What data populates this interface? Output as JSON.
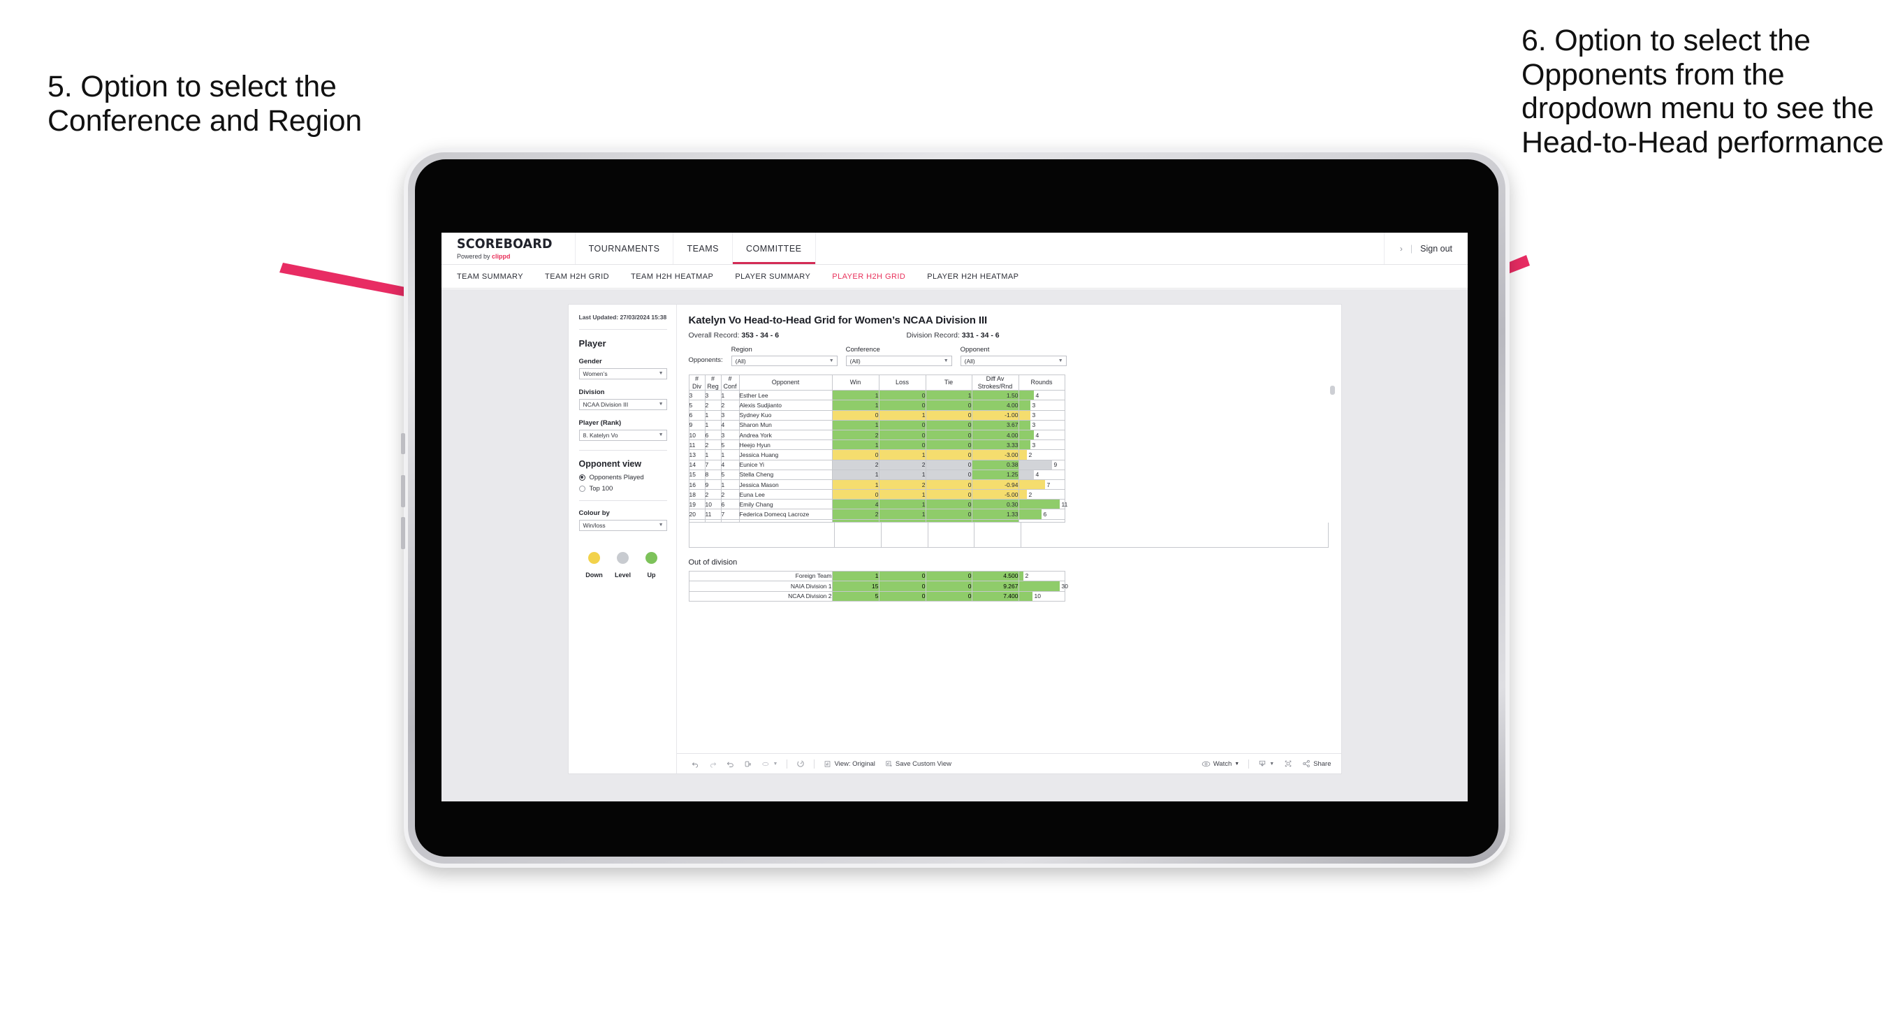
{
  "annotations": {
    "left": "5. Option to select the Conference and Region",
    "right": "6. Option to select the Opponents from the dropdown menu to see the Head-to-Head performance",
    "arrow_color": "#e82c63"
  },
  "app": {
    "brand": {
      "name": "SCOREBOARD",
      "powered_prefix": "Powered by ",
      "powered_brand": "clippd"
    },
    "nav": [
      {
        "label": "TOURNAMENTS",
        "active": false
      },
      {
        "label": "TEAMS",
        "active": false
      },
      {
        "label": "COMMITTEE",
        "active": true
      }
    ],
    "account": {
      "chevron": "›",
      "separator": "|",
      "sign_out": "Sign out"
    },
    "subtabs": [
      {
        "label": "TEAM SUMMARY",
        "active": false
      },
      {
        "label": "TEAM H2H GRID",
        "active": false
      },
      {
        "label": "TEAM H2H HEATMAP",
        "active": false
      },
      {
        "label": "PLAYER SUMMARY",
        "active": false
      },
      {
        "label": "PLAYER H2H GRID",
        "active": true
      },
      {
        "label": "PLAYER H2H HEATMAP",
        "active": false
      }
    ],
    "accent_color": "#e8305a"
  },
  "sidebar": {
    "last_updated": "Last Updated: 27/03/2024 15:38",
    "player_heading": "Player",
    "gender": {
      "label": "Gender",
      "value": "Women’s"
    },
    "division": {
      "label": "Division",
      "value": "NCAA Division III"
    },
    "player_rank": {
      "label": "Player (Rank)",
      "value": "8. Katelyn Vo"
    },
    "opponent_view": {
      "heading": "Opponent view",
      "options": [
        {
          "label": "Opponents Played",
          "selected": true
        },
        {
          "label": "Top 100",
          "selected": false
        }
      ]
    },
    "colour_by": {
      "label": "Colour by",
      "value": "Win/loss"
    },
    "legend": [
      {
        "label": "Down",
        "color": "#f2d24b"
      },
      {
        "label": "Level",
        "color": "#c8cbd0"
      },
      {
        "label": "Up",
        "color": "#7dc25a"
      }
    ]
  },
  "content": {
    "title": "Katelyn Vo Head-to-Head Grid for Women’s NCAA Division III",
    "overall_record_label": "Overall Record: ",
    "overall_record_value": "353 - 34 - 6",
    "division_record_label": "Division Record: ",
    "division_record_value": "331 -  34 - 6",
    "filters": {
      "opponents_label": "Opponents:",
      "fields": [
        {
          "label": "Region",
          "value": "(All)"
        },
        {
          "label": "Conference",
          "value": "(All)"
        },
        {
          "label": "Opponent",
          "value": "(All)"
        }
      ]
    },
    "out_of_division_title": "Out of division"
  },
  "chart_data": {
    "type": "table",
    "title": "Katelyn Vo Head-to-Head Grid for Women’s NCAA Division III",
    "columns": [
      "# Div",
      "# Reg",
      "# Conf",
      "Opponent",
      "Win",
      "Loss",
      "Tie",
      "Diff Av Strokes/Rnd",
      "Rounds"
    ],
    "column_headers_multiline": [
      [
        "#",
        "Div"
      ],
      [
        "#",
        "Reg"
      ],
      [
        "#",
        "Conf"
      ],
      [
        "Opponent"
      ],
      [
        "Win"
      ],
      [
        "Loss"
      ],
      [
        "Tie"
      ],
      [
        "Diff Av",
        "Strokes/Rnd"
      ],
      [
        "Rounds"
      ]
    ],
    "rounds_max": 11,
    "colors": {
      "up": "#8fcc6a",
      "down": "#f5dd6e",
      "level": "#d2d4d8"
    },
    "rows": [
      {
        "div": "3",
        "reg": "3",
        "conf": "1",
        "opponent": "Esther Lee",
        "win": "1",
        "loss": "0",
        "tie": "1",
        "diff": "1.50",
        "rounds": 4,
        "state": "up"
      },
      {
        "div": "5",
        "reg": "2",
        "conf": "2",
        "opponent": "Alexis Sudjianto",
        "win": "1",
        "loss": "0",
        "tie": "0",
        "diff": "4.00",
        "rounds": 3,
        "state": "up"
      },
      {
        "div": "6",
        "reg": "1",
        "conf": "3",
        "opponent": "Sydney Kuo",
        "win": "0",
        "loss": "1",
        "tie": "0",
        "diff": "-1.00",
        "rounds": 3,
        "state": "down"
      },
      {
        "div": "9",
        "reg": "1",
        "conf": "4",
        "opponent": "Sharon Mun",
        "win": "1",
        "loss": "0",
        "tie": "0",
        "diff": "3.67",
        "rounds": 3,
        "state": "up"
      },
      {
        "div": "10",
        "reg": "6",
        "conf": "3",
        "opponent": "Andrea York",
        "win": "2",
        "loss": "0",
        "tie": "0",
        "diff": "4.00",
        "rounds": 4,
        "state": "up"
      },
      {
        "div": "11",
        "reg": "2",
        "conf": "5",
        "opponent": "Heejo Hyun",
        "win": "1",
        "loss": "0",
        "tie": "0",
        "diff": "3.33",
        "rounds": 3,
        "state": "up"
      },
      {
        "div": "13",
        "reg": "1",
        "conf": "1",
        "opponent": "Jessica Huang",
        "win": "0",
        "loss": "1",
        "tie": "0",
        "diff": "-3.00",
        "rounds": 2,
        "state": "down"
      },
      {
        "div": "14",
        "reg": "7",
        "conf": "4",
        "opponent": "Eunice Yi",
        "win": "2",
        "loss": "2",
        "tie": "0",
        "diff": "0.38",
        "rounds": 9,
        "state": "level",
        "diff_state": "up"
      },
      {
        "div": "15",
        "reg": "8",
        "conf": "5",
        "opponent": "Stella Cheng",
        "win": "1",
        "loss": "1",
        "tie": "0",
        "diff": "1.25",
        "rounds": 4,
        "state": "level",
        "diff_state": "up"
      },
      {
        "div": "16",
        "reg": "9",
        "conf": "1",
        "opponent": "Jessica Mason",
        "win": "1",
        "loss": "2",
        "tie": "0",
        "diff": "-0.94",
        "rounds": 7,
        "state": "down"
      },
      {
        "div": "18",
        "reg": "2",
        "conf": "2",
        "opponent": "Euna Lee",
        "win": "0",
        "loss": "1",
        "tie": "0",
        "diff": "-5.00",
        "rounds": 2,
        "state": "down"
      },
      {
        "div": "19",
        "reg": "10",
        "conf": "6",
        "opponent": "Emily Chang",
        "win": "4",
        "loss": "1",
        "tie": "0",
        "diff": "0.30",
        "rounds": 11,
        "state": "up"
      },
      {
        "div": "20",
        "reg": "11",
        "conf": "7",
        "opponent": "Federica Domecq Lacroze",
        "win": "2",
        "loss": "1",
        "tie": "0",
        "diff": "1.33",
        "rounds": 6,
        "state": "up"
      }
    ],
    "out_of_division": {
      "rounds_max": 30,
      "rows": [
        {
          "name": "Foreign Team",
          "win": "1",
          "loss": "0",
          "tie": "0",
          "diff": "4.500",
          "rounds": 2,
          "state": "up"
        },
        {
          "name": "NAIA Division 1",
          "win": "15",
          "loss": "0",
          "tie": "0",
          "diff": "9.267",
          "rounds": 30,
          "state": "up"
        },
        {
          "name": "NCAA Division 2",
          "win": "5",
          "loss": "0",
          "tie": "0",
          "diff": "7.400",
          "rounds": 10,
          "state": "up"
        }
      ]
    }
  },
  "toolbar": {
    "items": [
      {
        "name": "undo-icon",
        "label": ""
      },
      {
        "name": "redo-icon",
        "label": ""
      },
      {
        "name": "revert-icon",
        "label": ""
      },
      {
        "name": "pause-icon",
        "label": ""
      },
      {
        "name": "refresh-icon",
        "label": ""
      },
      {
        "name": "view-original-icon",
        "label": "View: Original"
      },
      {
        "name": "save-view-icon",
        "label": "Save Custom View"
      },
      {
        "name": "watch-icon",
        "label": "Watch"
      },
      {
        "name": "download-icon",
        "label": ""
      },
      {
        "name": "fullscreen-icon",
        "label": ""
      },
      {
        "name": "share-icon",
        "label": "Share"
      }
    ]
  }
}
